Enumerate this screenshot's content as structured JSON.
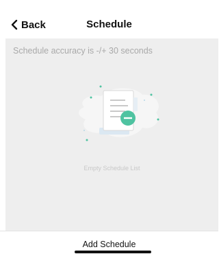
{
  "colors": {
    "accent": "#f4b33a",
    "teal": "#4fc3a1",
    "content_bg": "#eeeeee"
  },
  "status_bar": {
    "indicator_icon": "caret-down-icon"
  },
  "nav": {
    "back_icon": "chevron-left-icon",
    "back_label": "Back",
    "title": "Schedule"
  },
  "content": {
    "accuracy_note": "Schedule accuracy is -/+ 30 seconds",
    "empty_illustration_icon": "empty-document-icon",
    "empty_text": "Empty Schedule List"
  },
  "footer": {
    "add_label": "Add Schedule"
  }
}
